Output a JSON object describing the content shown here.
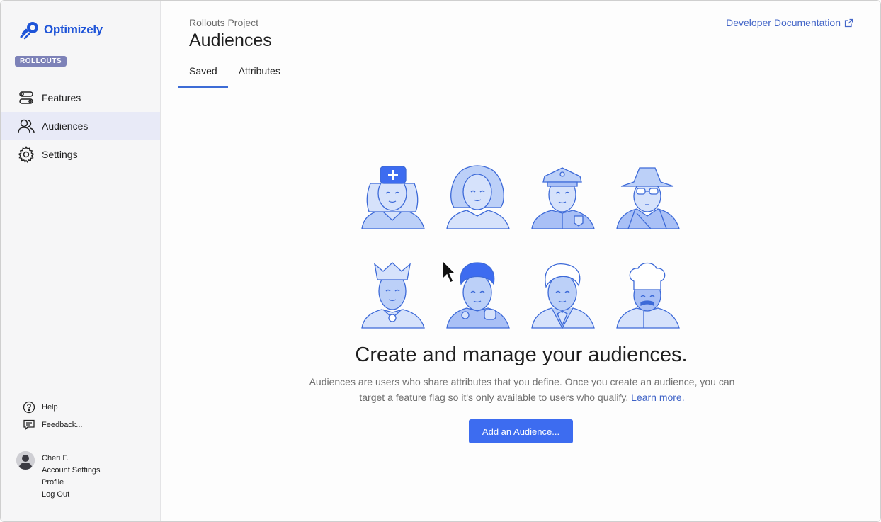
{
  "brand": {
    "name": "Optimizely",
    "badge": "ROLLOUTS",
    "color": "#1e54d8"
  },
  "sidebar": {
    "items": [
      {
        "label": "Features",
        "icon": "toggles-icon",
        "active": false
      },
      {
        "label": "Audiences",
        "icon": "people-icon",
        "active": true
      },
      {
        "label": "Settings",
        "icon": "gear-icon",
        "active": false
      }
    ],
    "help": {
      "label": "Help",
      "icon": "question-circle-icon"
    },
    "feedback": {
      "label": "Feedback...",
      "icon": "chat-bubble-icon"
    },
    "account": {
      "name": "Cheri F.",
      "account_settings": "Account Settings",
      "profile": "Profile",
      "logout": "Log Out"
    }
  },
  "header": {
    "project": "Rollouts Project",
    "title": "Audiences",
    "dev_docs": "Developer Documentation",
    "tabs": [
      {
        "label": "Saved",
        "active": true
      },
      {
        "label": "Attributes",
        "active": false
      }
    ]
  },
  "empty_state": {
    "title": "Create and manage your audiences.",
    "description": "Audiences are users who share attributes that you define. Once you create an audience, you can target a feature flag so it's only available to users who qualify.",
    "learn_more": "Learn more.",
    "button": "Add an Audience..."
  },
  "colors": {
    "accent": "#3d6cf0",
    "link": "#4466c8",
    "illustration_fill": "#a9c0f6",
    "illustration_stroke": "#3d6ad8"
  }
}
